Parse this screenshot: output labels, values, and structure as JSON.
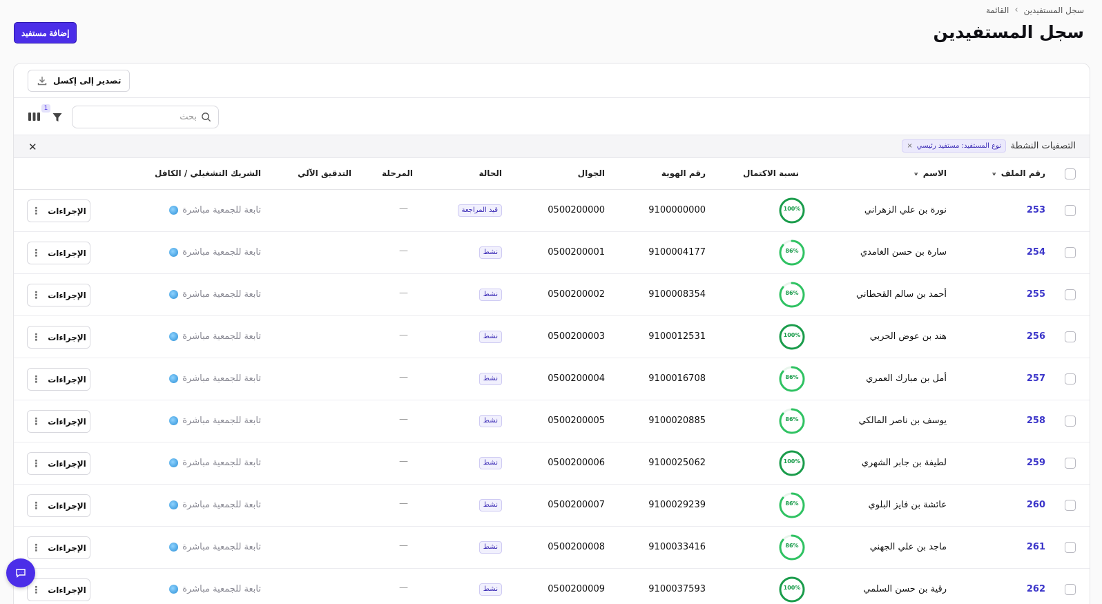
{
  "breadcrumb": {
    "parent": "القائمة",
    "current": "سجل المستفيدين",
    "separator": "›"
  },
  "header": {
    "title": "سجل المستفيدين",
    "add_button": "إضافة مستفيد"
  },
  "toolbar": {
    "export_label": "تصدير إلى إكسل",
    "search_placeholder": "بحث",
    "filter_count": "1"
  },
  "active_filters": {
    "label": "التصفيات النشطة",
    "chip": "نوع المستفيد: مستفيد رئيسي",
    "chip_remove": "×",
    "clear": "✕"
  },
  "columns": {
    "file_no": "رقم الملف",
    "name": "الاسم",
    "completion": "نسبة الاكتمال",
    "national_id": "رقم الهوية",
    "mobile": "الجوال",
    "status": "الحالة",
    "stage": "المرحلة",
    "auto_check": "التدقيق الآلي",
    "partner": "الشريك التشغيلي / الكافل"
  },
  "actions_label": "الإجراءات",
  "colors": {
    "accent": "#4b2ee8",
    "ring_full": "#1a9c4b",
    "ring_partial": "#2fc262",
    "file_link": "#3b35c9"
  },
  "rows": [
    {
      "file_no": "253",
      "name": "نورة بن علي الزهراني",
      "completion": "100%",
      "completion_value": 100,
      "national_id": "9100000000",
      "mobile": "0500200000",
      "status": "قيد المراجعة",
      "stage": "—",
      "auto_check": "",
      "partner": "تابعة للجمعية مباشرة"
    },
    {
      "file_no": "254",
      "name": "سارة بن حسن الغامدي",
      "completion": "86%",
      "completion_value": 86,
      "national_id": "9100004177",
      "mobile": "0500200001",
      "status": "نشط",
      "stage": "—",
      "auto_check": "",
      "partner": "تابعة للجمعية مباشرة"
    },
    {
      "file_no": "255",
      "name": "أحمد بن سالم القحطاني",
      "completion": "86%",
      "completion_value": 86,
      "national_id": "9100008354",
      "mobile": "0500200002",
      "status": "نشط",
      "stage": "—",
      "auto_check": "",
      "partner": "تابعة للجمعية مباشرة"
    },
    {
      "file_no": "256",
      "name": "هند بن عوض الحربي",
      "completion": "100%",
      "completion_value": 100,
      "national_id": "9100012531",
      "mobile": "0500200003",
      "status": "نشط",
      "stage": "—",
      "auto_check": "",
      "partner": "تابعة للجمعية مباشرة"
    },
    {
      "file_no": "257",
      "name": "أمل بن مبارك العمري",
      "completion": "86%",
      "completion_value": 86,
      "national_id": "9100016708",
      "mobile": "0500200004",
      "status": "نشط",
      "stage": "—",
      "auto_check": "",
      "partner": "تابعة للجمعية مباشرة"
    },
    {
      "file_no": "258",
      "name": "يوسف بن ناصر المالكي",
      "completion": "86%",
      "completion_value": 86,
      "national_id": "9100020885",
      "mobile": "0500200005",
      "status": "نشط",
      "stage": "—",
      "auto_check": "",
      "partner": "تابعة للجمعية مباشرة"
    },
    {
      "file_no": "259",
      "name": "لطيفة بن جابر الشهري",
      "completion": "100%",
      "completion_value": 100,
      "national_id": "9100025062",
      "mobile": "0500200006",
      "status": "نشط",
      "stage": "—",
      "auto_check": "",
      "partner": "تابعة للجمعية مباشرة"
    },
    {
      "file_no": "260",
      "name": "عائشة بن فايز البلوي",
      "completion": "86%",
      "completion_value": 86,
      "national_id": "9100029239",
      "mobile": "0500200007",
      "status": "نشط",
      "stage": "—",
      "auto_check": "",
      "partner": "تابعة للجمعية مباشرة"
    },
    {
      "file_no": "261",
      "name": "ماجد بن علي الجهني",
      "completion": "86%",
      "completion_value": 86,
      "national_id": "9100033416",
      "mobile": "0500200008",
      "status": "نشط",
      "stage": "—",
      "auto_check": "",
      "partner": "تابعة للجمعية مباشرة"
    },
    {
      "file_no": "262",
      "name": "رقية بن حسن السلمي",
      "completion": "100%",
      "completion_value": 100,
      "national_id": "9100037593",
      "mobile": "0500200009",
      "status": "نشط",
      "stage": "—",
      "auto_check": "",
      "partner": "تابعة للجمعية مباشرة"
    }
  ]
}
